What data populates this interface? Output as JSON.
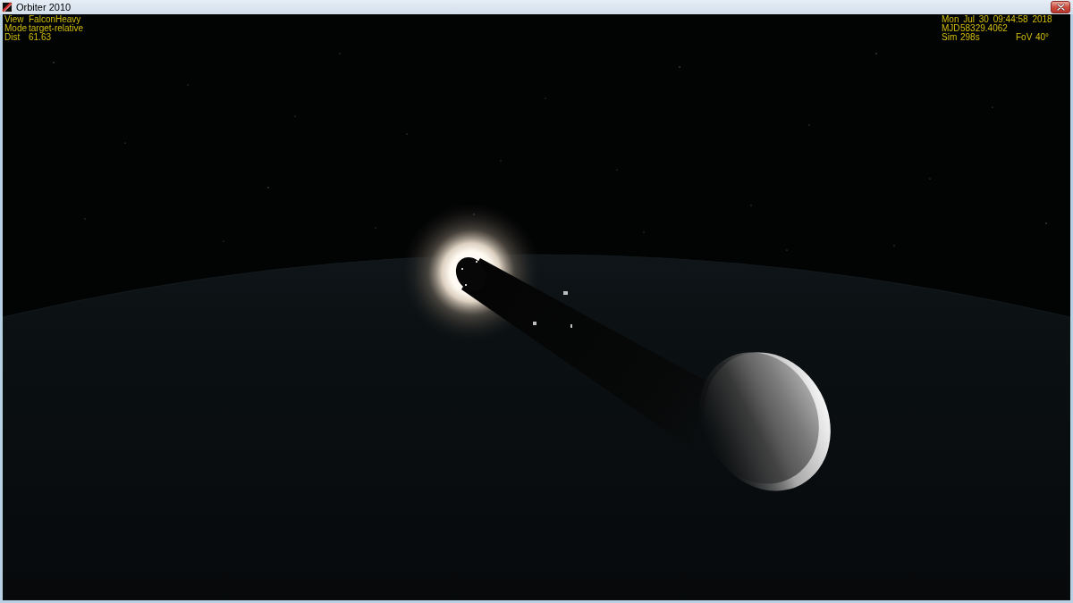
{
  "window": {
    "title": "Orbiter 2010"
  },
  "hud_left": [
    {
      "label": "View",
      "value": "FalconHeavy"
    },
    {
      "label": "Mode",
      "value": "target-relative"
    },
    {
      "label": "Dist",
      "value": "61.63"
    }
  ],
  "hud_right": {
    "clock": "Mon Jul 30 09:44:58 2018",
    "mjd": {
      "label": "MJD",
      "value": "58329.4062"
    },
    "sim": {
      "label": "Sim",
      "value": "298s"
    },
    "fov": {
      "label": "FoV",
      "value": "40°"
    }
  }
}
